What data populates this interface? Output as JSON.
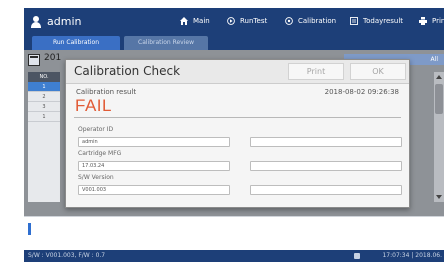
{
  "header": {
    "user": "admin",
    "nav": [
      {
        "label": "Main",
        "icon": "home-icon"
      },
      {
        "label": "RunTest",
        "icon": "play-icon"
      },
      {
        "label": "Calibration",
        "icon": "calibration-icon"
      },
      {
        "label": "Todayresult",
        "icon": "list-icon"
      },
      {
        "label": "Prin",
        "icon": "printer-icon"
      }
    ]
  },
  "tabs": [
    "Run Calibration",
    "Calibration Review"
  ],
  "background": {
    "year_partial": "201",
    "select_all_partial": "All",
    "list_header": "NO.",
    "list_rows": [
      "1",
      "2",
      "3",
      "1"
    ]
  },
  "dialog": {
    "title": "Calibration Check",
    "print_label": "Print",
    "ok_label": "OK",
    "result_label": "Calibration result",
    "result_value": "FAIL",
    "result_datetime": "2018-08-02 09:26:38",
    "fields": [
      {
        "label": "Operator ID",
        "value": "admin",
        "right_value": ""
      },
      {
        "label": "Cartridge MFG",
        "value": "17.03.24",
        "right_value": ""
      },
      {
        "label": "S/W Version",
        "value": "V001.003",
        "right_value": ""
      }
    ]
  },
  "status": {
    "sw_version": "S/W : V001.003, F/W : 0.7",
    "datetime": "17:07:34 | 2018.06."
  },
  "colors": {
    "nav_bg": "#1d3f78",
    "active_tab": "#3a6fc4",
    "fail_text": "#e15b36"
  }
}
